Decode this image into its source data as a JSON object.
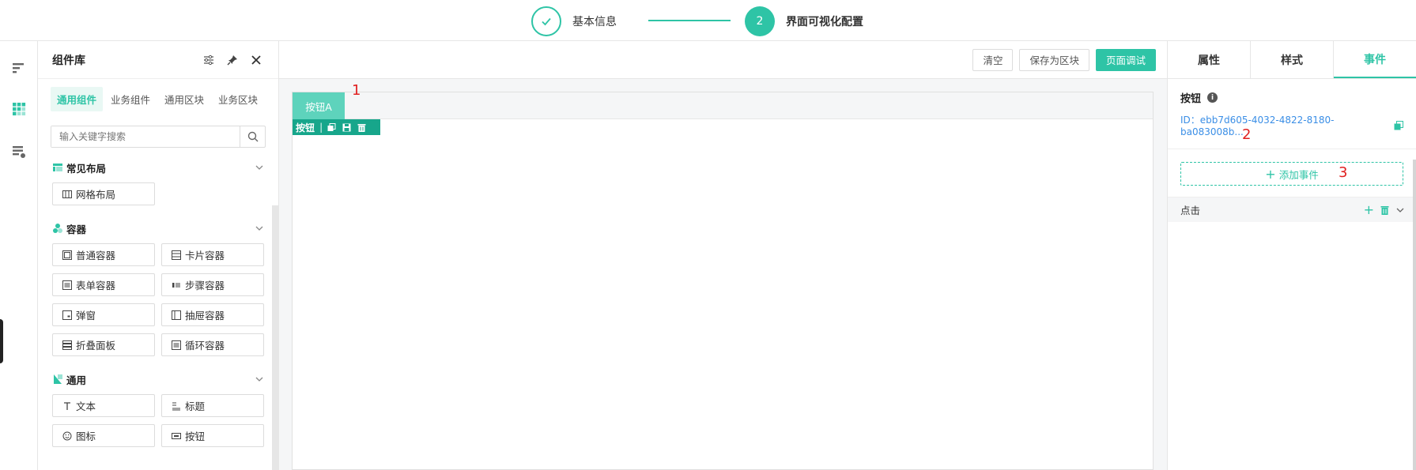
{
  "steps": [
    {
      "label": "基本信息",
      "status": "done"
    },
    {
      "label": "界面可视化配置",
      "number": "2",
      "status": "active"
    }
  ],
  "library": {
    "title": "组件库",
    "tabs": [
      "通用组件",
      "业务组件",
      "通用区块",
      "业务区块"
    ],
    "search_placeholder": "输入关键字搜索",
    "groups": [
      {
        "title": "常见布局",
        "items": [
          "网格布局"
        ]
      },
      {
        "title": "容器",
        "items": [
          "普通容器",
          "卡片容器",
          "表单容器",
          "步骤容器",
          "弹窗",
          "抽屉容器",
          "折叠面板",
          "循环容器"
        ]
      },
      {
        "title": "通用",
        "items": [
          "文本",
          "标题",
          "图标",
          "按钮"
        ]
      }
    ]
  },
  "toolbar": {
    "clear": "清空",
    "save_block": "保存为区块",
    "debug": "页面调试"
  },
  "canvas": {
    "tab_label": "按钮A",
    "selection_label": "按钮",
    "markers": [
      "1",
      "2",
      "3"
    ]
  },
  "props": {
    "tabs": [
      "属性",
      "样式",
      "事件"
    ],
    "component_name": "按钮",
    "component_id": "ID：ebb7d605-4032-4822-8180-ba083008b...",
    "add_event": "添加事件",
    "event_name": "点击"
  },
  "colors": {
    "accent": "#2ec4a6",
    "link": "#3a8ee6",
    "marker": "#e02020"
  }
}
